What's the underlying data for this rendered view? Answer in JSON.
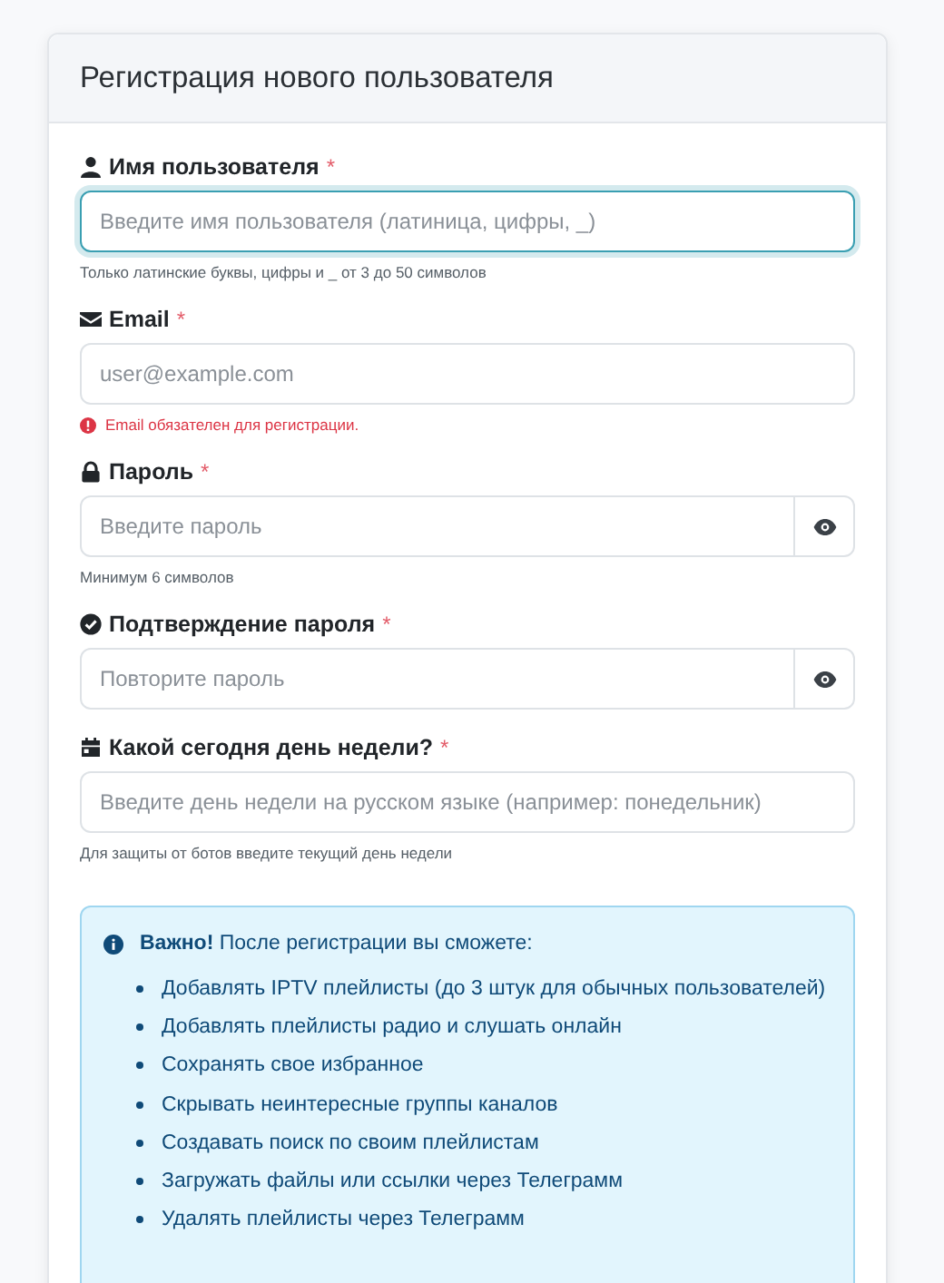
{
  "card": {
    "title": "Регистрация нового пользователя"
  },
  "fields": [
    {
      "kind": "text",
      "label": "Имя пользователя",
      "required": "*",
      "placeholder": "Введите имя пользователя (латиница, цифры, _)",
      "focused": true,
      "hint": "Только латинские буквы, цифры и _ от 3 до 50 символов"
    },
    {
      "kind": "text",
      "label": "Email",
      "required": "*",
      "placeholder": "user@example.com",
      "focused": false,
      "error": "Email обязателен для регистрации."
    },
    {
      "kind": "password",
      "label": "Пароль",
      "required": "*",
      "placeholder": "Введите пароль",
      "focused": false,
      "hint": "Минимум 6 символов"
    },
    {
      "kind": "password",
      "label": "Подтверждение пароля",
      "required": "*",
      "placeholder": "Повторите пароль",
      "focused": false
    },
    {
      "kind": "text",
      "label": "Какой сегодня день недели?",
      "required": "*",
      "placeholder": "Введите день недели на русском языке (например: понедельник)",
      "focused": false,
      "hint": "Для защиты от ботов введите текущий день недели"
    }
  ],
  "info": {
    "text": "**Важно!** После регистрации вы сможете:",
    "items": [
      "Добавлять IPTV плейлисты (до 3 штук для обычных пользователей)",
      "Добавлять плейлисты радио и слушать онлайн",
      "Сохранять свое избранное",
      "Скрывать неинтересные группы каналов",
      "Создавать поиск по своим плейлистам",
      "Загружать файлы или ссылки через Телеграмм",
      "Удалять плейлисты через Телеграмм"
    ]
  }
}
